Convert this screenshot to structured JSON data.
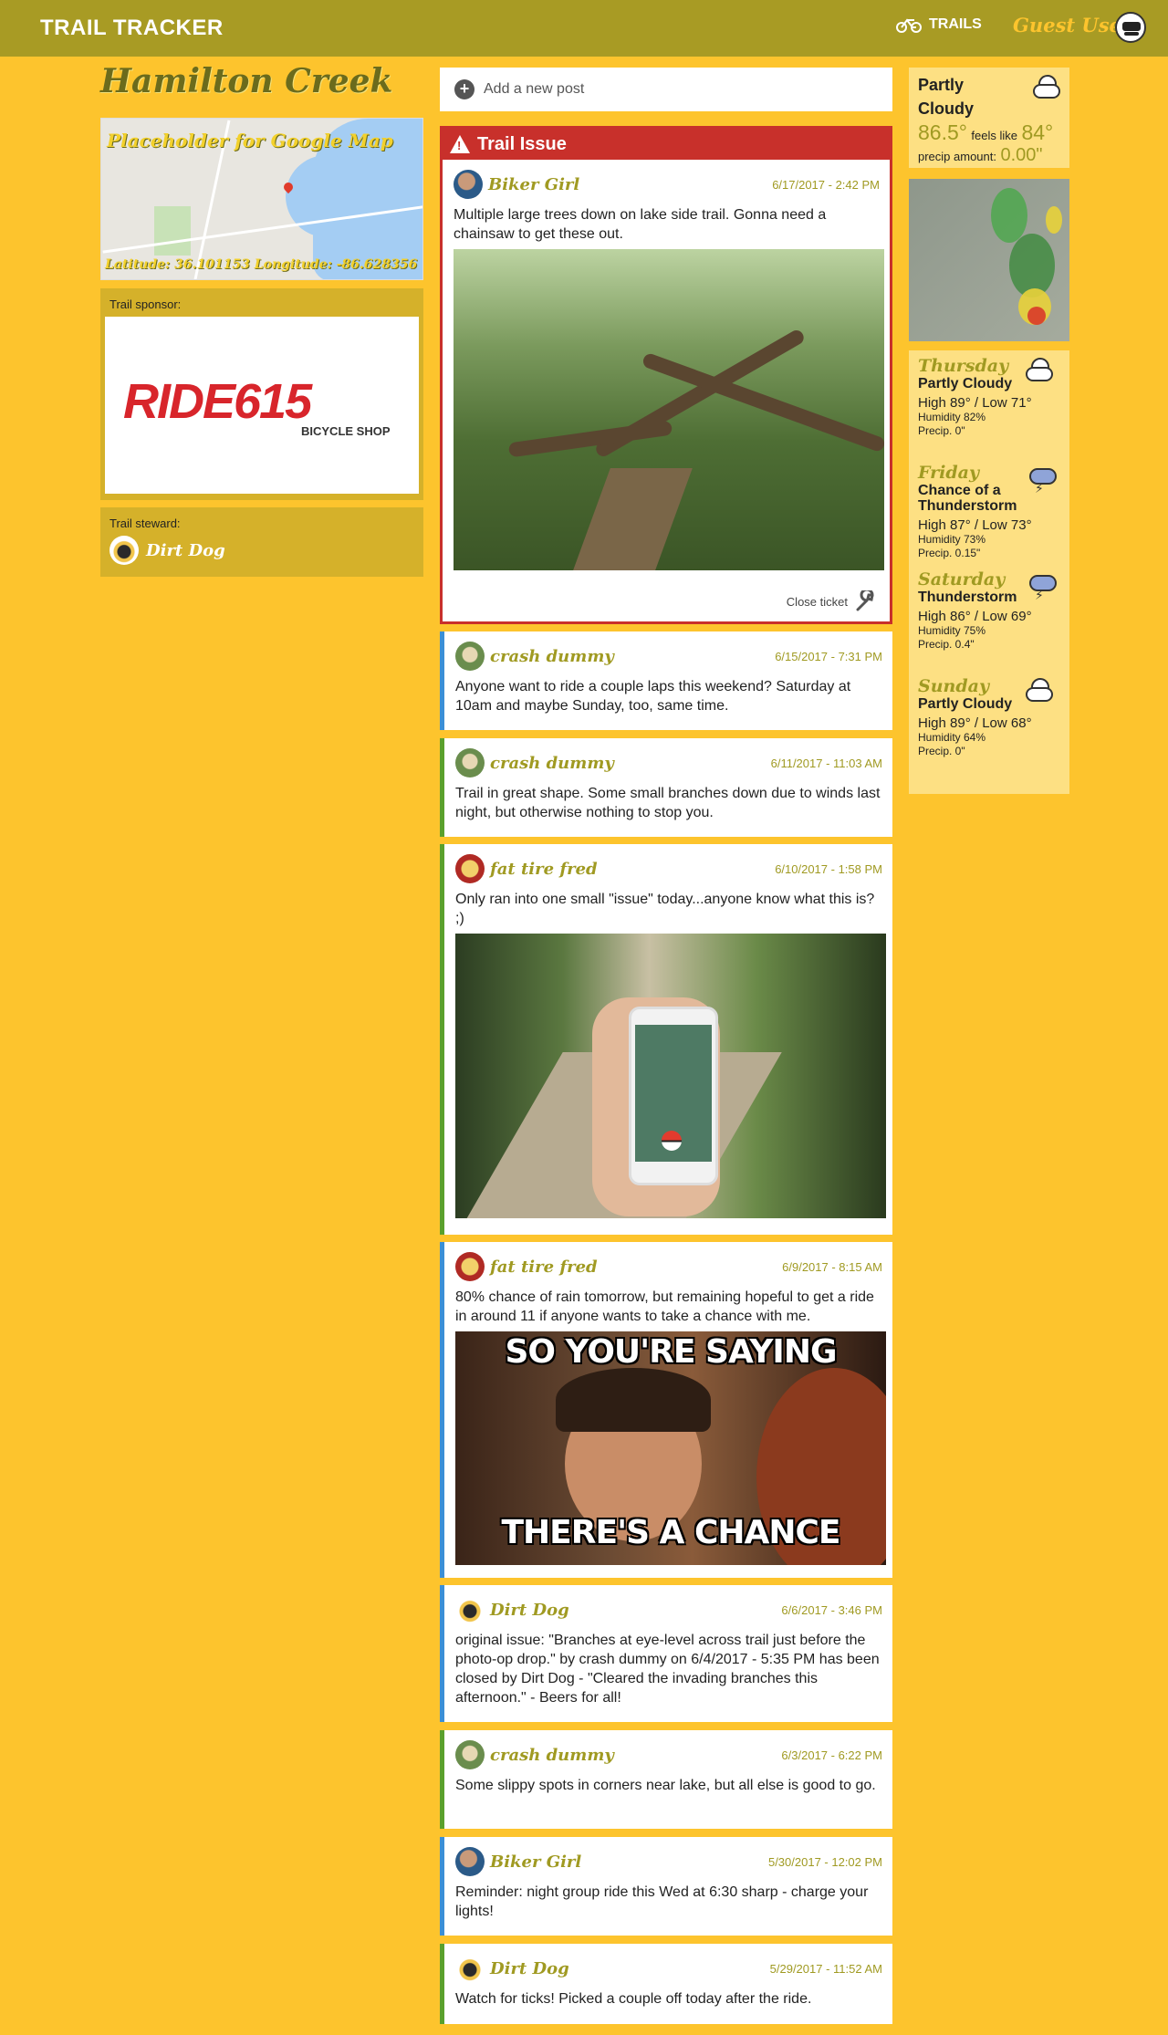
{
  "header": {
    "brand": "TRAIL TRACKER",
    "nav_trails": "TRAILS",
    "user_name": "Guest User"
  },
  "trail": {
    "title": "Hamilton Creek",
    "map_placeholder": "Placeholder for Google Map",
    "map_coords": "Latitude: 36.101153 Longitude: -86.628356",
    "sponsor_label": "Trail sponsor:",
    "sponsor_logo": "RIDE615",
    "sponsor_sub": "BICYCLE SHOP",
    "steward_label": "Trail steward:",
    "steward_name": "Dirt Dog"
  },
  "feed": {
    "add_post": "Add a new post",
    "issue": {
      "header": "Trail Issue",
      "author": "Biker Girl",
      "date": "6/17/2017 - 2:42 PM",
      "text": "Multiple large trees down on lake side trail. Gonna need a chainsaw to get these out.",
      "close_label": "Close ticket"
    },
    "posts": [
      {
        "author": "crash dummy",
        "date": "6/15/2017 - 7:31 PM",
        "text": "Anyone want to ride a couple laps this weekend? Saturday at 10am and maybe Sunday, too, same time."
      },
      {
        "author": "crash dummy",
        "date": "6/11/2017 - 11:03 AM",
        "text": "Trail in great shape. Some small branches down due to winds last night, but otherwise nothing to stop you."
      },
      {
        "author": "fat tire fred",
        "date": "6/10/2017 - 1:58 PM",
        "text": "Only ran into one small \"issue\" today...anyone know what this is? ;)"
      },
      {
        "author": "fat tire fred",
        "date": "6/9/2017 - 8:15 AM",
        "text": "80% chance of rain tomorrow, but remaining hopeful to get a ride in around 11 if anyone wants to take a chance with me.",
        "meme_top": "SO YOU'RE SAYING",
        "meme_bottom": "THERE'S A CHANCE"
      },
      {
        "author": "Dirt Dog",
        "date": "6/6/2017 - 3:46 PM",
        "text": "original issue: \"Branches at eye-level across trail just before the photo-op drop.\" by crash dummy on 6/4/2017 - 5:35 PM has been closed by Dirt Dog - \"Cleared the invading branches this afternoon.\" - Beers for all!"
      },
      {
        "author": "crash dummy",
        "date": "6/3/2017 - 6:22 PM",
        "text": "Some slippy spots in corners near lake, but all else is good to go."
      },
      {
        "author": "Biker Girl",
        "date": "5/30/2017 - 12:02 PM",
        "text": "Reminder: night group ride this Wed at 6:30 sharp - charge your lights!"
      },
      {
        "author": "Dirt Dog",
        "date": "5/29/2017 - 11:52 AM",
        "text": "Watch for ticks! Picked a couple off today after the ride."
      }
    ]
  },
  "weather": {
    "current": {
      "condition": "Partly Cloudy",
      "temp": "86.5°",
      "feels_label": "feels like",
      "feels": "84°",
      "precip_label": "precip amount:",
      "precip": "0.00\""
    },
    "forecast": [
      {
        "day": "Thursday",
        "condition": "Partly Cloudy",
        "hilo": "High 89° / Low 71°",
        "humidity": "Humidity 82%",
        "precip": "Precip. 0\"",
        "icon": "partly-cloudy-icon"
      },
      {
        "day": "Friday",
        "condition": "Chance of a Thunderstorm",
        "hilo": "High 87° / Low 73°",
        "humidity": "Humidity 73%",
        "precip": "Precip. 0.15\"",
        "icon": "thunderstorm-icon"
      },
      {
        "day": "Saturday",
        "condition": "Thunderstorm",
        "hilo": "High 86° / Low 69°",
        "humidity": "Humidity 75%",
        "precip": "Precip. 0.4\"",
        "icon": "thunderstorm-icon"
      },
      {
        "day": "Sunday",
        "condition": "Partly Cloudy",
        "hilo": "High 89° / Low 68°",
        "humidity": "Humidity 64%",
        "precip": "Precip. 0\"",
        "icon": "partly-cloudy-icon"
      }
    ]
  },
  "colors": {
    "background": "#fdc42d",
    "header": "#a89b24",
    "issue_red": "#c8302b",
    "accent_olive": "#a09a22"
  }
}
